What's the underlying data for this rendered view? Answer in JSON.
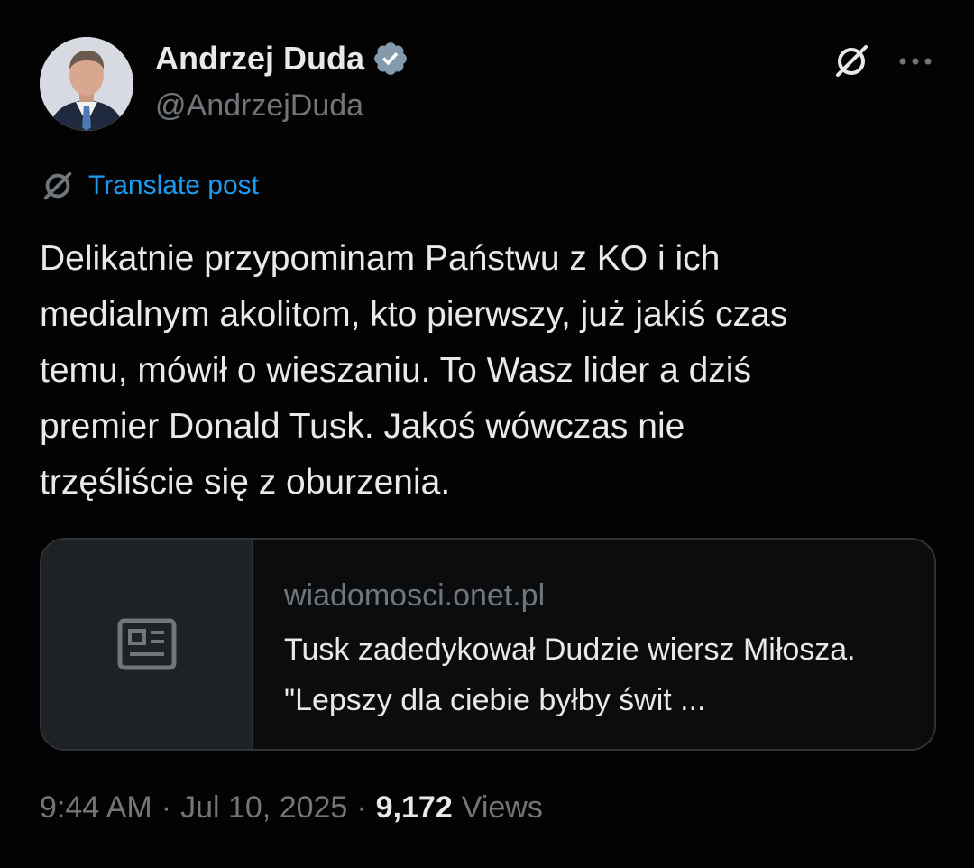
{
  "author": {
    "name": "Andrzej Duda",
    "handle": "@AndrzejDuda",
    "verified": true,
    "avatar_icon": "profile-photo"
  },
  "header": {
    "grok_icon": "grok-icon",
    "more_icon": "more-icon"
  },
  "translate": {
    "label": "Translate post",
    "icon": "grok-icon"
  },
  "post": {
    "text": "Delikatnie przypominam Państwu z KO i ich\nmedialnym akolitom, kto pierwszy, już jakiś czas\ntemu, mówił o wieszaniu. To Wasz lider a dziś\npremier Donald Tusk. Jakoś wówczas nie\ntrzęśliście się z oburzenia."
  },
  "link_card": {
    "domain": "wiadomosci.onet.pl",
    "title": "Tusk zadedykował Dudzie wiersz Miłosza. \"Lepszy dla ciebie byłby świt ...",
    "icon": "newspaper-icon"
  },
  "meta": {
    "time": "9:44 AM",
    "date": "Jul 10, 2025",
    "separator": "·",
    "views_count": "9,172",
    "views_label": "Views"
  },
  "colors": {
    "background": "#030303",
    "text": "#e7e9ea",
    "secondary": "#71767b",
    "link": "#1d9bf0",
    "verified": "#829aab",
    "border": "#2f3336"
  }
}
